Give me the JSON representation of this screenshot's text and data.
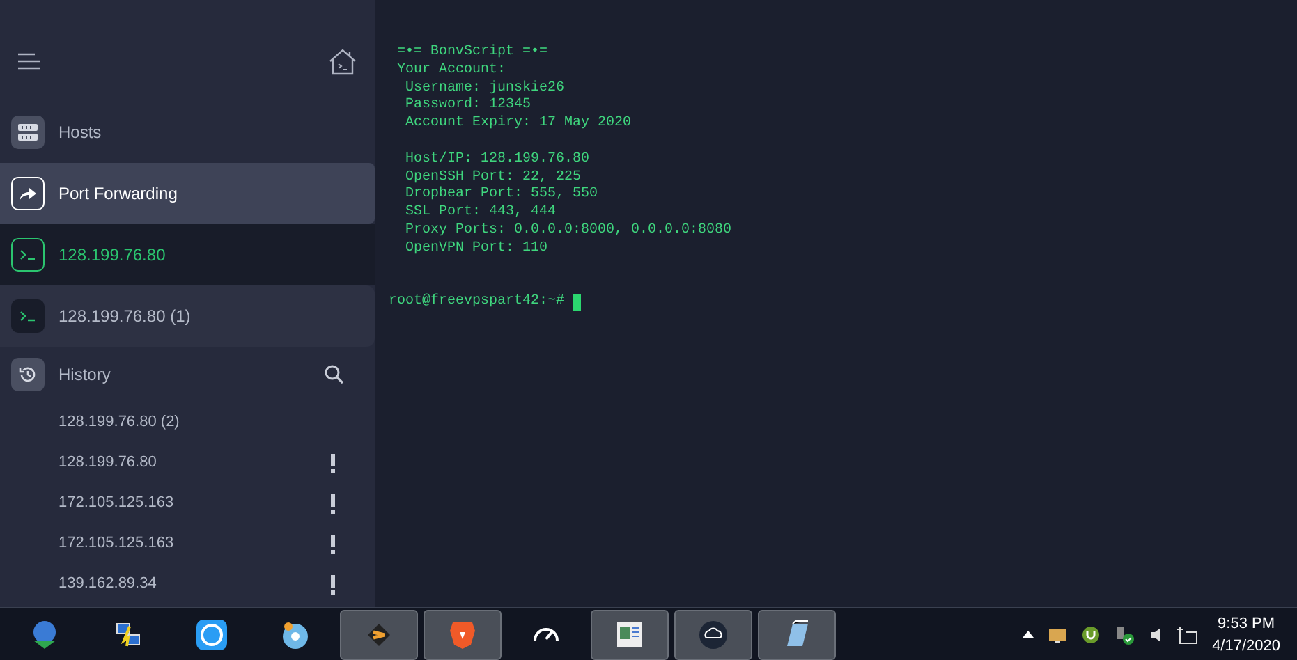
{
  "sidebar": {
    "nav": [
      {
        "label": "Hosts",
        "selected": false,
        "kind": "hosts"
      },
      {
        "label": "Port Forwarding",
        "selected": true,
        "kind": "forward"
      }
    ],
    "sessions": [
      {
        "label": "128.199.76.80",
        "active": true
      },
      {
        "label": "128.199.76.80 (1)",
        "active": false
      }
    ],
    "history": {
      "title": "History",
      "items": [
        {
          "label": "128.199.76.80 (2)",
          "warning": false
        },
        {
          "label": "128.199.76.80",
          "warning": true
        },
        {
          "label": "172.105.125.163",
          "warning": true
        },
        {
          "label": "172.105.125.163",
          "warning": true
        },
        {
          "label": "139.162.89.34",
          "warning": true
        }
      ]
    }
  },
  "terminal": {
    "banner": "=•= BonvScript =•=",
    "sections": [
      {
        "title": "Your Account:",
        "lines": [
          "Username: junskie26",
          "Password: 12345",
          "Account Expiry: 17 May 2020"
        ]
      },
      {
        "lines": [
          "Host/IP: 128.199.76.80",
          "OpenSSH Port: 22, 225",
          "Dropbear Port: 555, 550",
          "SSL Port: 443, 444",
          "Proxy Ports: 0.0.0.0:8000, 0.0.0.0:8080",
          "OpenVPN Port: 110"
        ]
      }
    ],
    "prompt": "root@freevpspart42:~#"
  },
  "taskbar": {
    "apps": [
      {
        "highlighted": false
      },
      {
        "highlighted": false
      },
      {
        "highlighted": false
      },
      {
        "highlighted": false
      },
      {
        "highlighted": true
      },
      {
        "highlighted": true
      },
      {
        "highlighted": false
      },
      {
        "highlighted": true
      },
      {
        "highlighted": true
      },
      {
        "highlighted": true
      }
    ],
    "time": "9:53 PM",
    "date": "4/17/2020"
  }
}
